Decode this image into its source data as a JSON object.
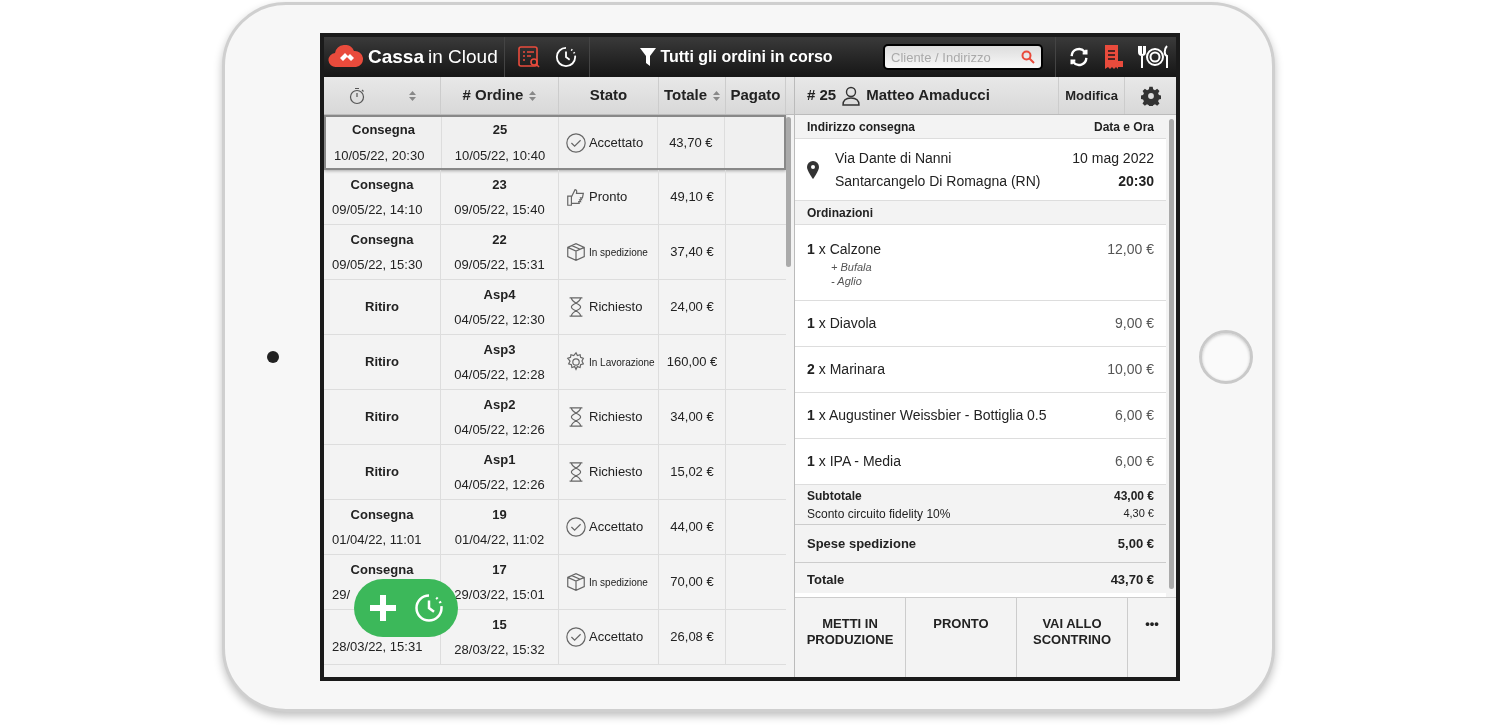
{
  "topbar": {
    "logo": {
      "bold": "Cassa",
      "light": "in Cloud"
    },
    "filter": "Tutti gli ordini in corso",
    "search": {
      "placeholder": "Cliente / Indirizzo"
    }
  },
  "table": {
    "columns": [
      {
        "label": "# Ordine",
        "sort": true
      },
      {
        "label": "Stato",
        "sort": false
      },
      {
        "label": "Totale",
        "sort": true
      },
      {
        "label": "Pagato",
        "sort": false
      }
    ],
    "rows": [
      {
        "selected": true,
        "type": "Consegna",
        "when": "10/05/22, 20:30",
        "order": "25",
        "created": "10/05/22, 10:40",
        "status": {
          "kind": "check",
          "label": "Accettato"
        },
        "total": "43,70 €"
      },
      {
        "selected": false,
        "type": "Consegna",
        "when": "09/05/22, 14:10",
        "order": "23",
        "created": "09/05/22, 15:40",
        "status": {
          "kind": "thumb",
          "label": "Pronto"
        },
        "total": "49,10 €"
      },
      {
        "selected": false,
        "type": "Consegna",
        "when": "09/05/22, 15:30",
        "order": "22",
        "created": "09/05/22, 15:31",
        "status": {
          "kind": "box",
          "label": "In spedizione"
        },
        "total": "37,40 €"
      },
      {
        "selected": false,
        "type": "Ritiro",
        "order": "Asp4",
        "created": "04/05/22, 12:30",
        "status": {
          "kind": "hourglass",
          "label": "Richiesto"
        },
        "total": "24,00 €"
      },
      {
        "selected": false,
        "type": "Ritiro",
        "order": "Asp3",
        "created": "04/05/22, 12:28",
        "status": {
          "kind": "gear",
          "label": "In Lavorazione"
        },
        "total": "160,00 €"
      },
      {
        "selected": false,
        "type": "Ritiro",
        "order": "Asp2",
        "created": "04/05/22, 12:26",
        "status": {
          "kind": "hourglass",
          "label": "Richiesto"
        },
        "total": "34,00 €"
      },
      {
        "selected": false,
        "type": "Ritiro",
        "order": "Asp1",
        "created": "04/05/22, 12:26",
        "status": {
          "kind": "hourglass",
          "label": "Richiesto"
        },
        "total": "15,02 €"
      },
      {
        "selected": false,
        "type": "Consegna",
        "when": "01/04/22, 11:01",
        "order": "19",
        "created": "01/04/22, 11:02",
        "status": {
          "kind": "check",
          "label": "Accettato"
        },
        "total": "44,00 €"
      },
      {
        "selected": false,
        "type": "Consegna",
        "when": "29/",
        "order": "17",
        "created": "29/03/22, 15:01",
        "status": {
          "kind": "box",
          "label": "In spedizione"
        },
        "total": "70,00 €"
      },
      {
        "selected": false,
        "when": "28/03/22, 15:31",
        "order": "15",
        "created": "28/03/22, 15:32",
        "status": {
          "kind": "check",
          "label": "Accettato"
        },
        "total": "26,08 €"
      }
    ]
  },
  "detail": {
    "number": "# 25",
    "customer": "Matteo Amaducci",
    "edit": "Modifica",
    "address_header": "Indirizzo consegna",
    "date_header": "Data e Ora",
    "address": [
      "Via Dante di Nanni",
      "Santarcangelo Di Romagna (RN)"
    ],
    "date": "10 mag 2022",
    "time": "20:30",
    "items_header": "Ordinazioni",
    "items": [
      {
        "qty": "1",
        "name": "x Calzone",
        "price": "12,00 €",
        "mods": [
          "+ Bufala",
          "- Aglio"
        ]
      },
      {
        "qty": "1",
        "name": "x Diavola",
        "price": "9,00 €"
      },
      {
        "qty": "2",
        "name": "x Marinara",
        "price": "10,00 €"
      },
      {
        "qty": "1",
        "name": "x Augustiner Weissbier - Bottiglia 0.5",
        "price": "6,00 €"
      },
      {
        "qty": "1",
        "name": "x IPA - Media",
        "price": "6,00 €"
      }
    ],
    "subtotal": {
      "label": "Subtotale",
      "value": "43,00 €",
      "discount_label": "Sconto circuito fidelity 10%",
      "discount_value": "4,30 €"
    },
    "shipping": {
      "label": "Spese spedizione",
      "value": "5,00 €"
    },
    "total": {
      "label": "Totale",
      "value": "43,70 €"
    },
    "actions": [
      {
        "label": "METTI IN PRODUZIONE"
      },
      {
        "label": "PRONTO"
      },
      {
        "label": "VAI ALLO SCONTRINO"
      },
      {
        "label": "•••"
      }
    ]
  }
}
